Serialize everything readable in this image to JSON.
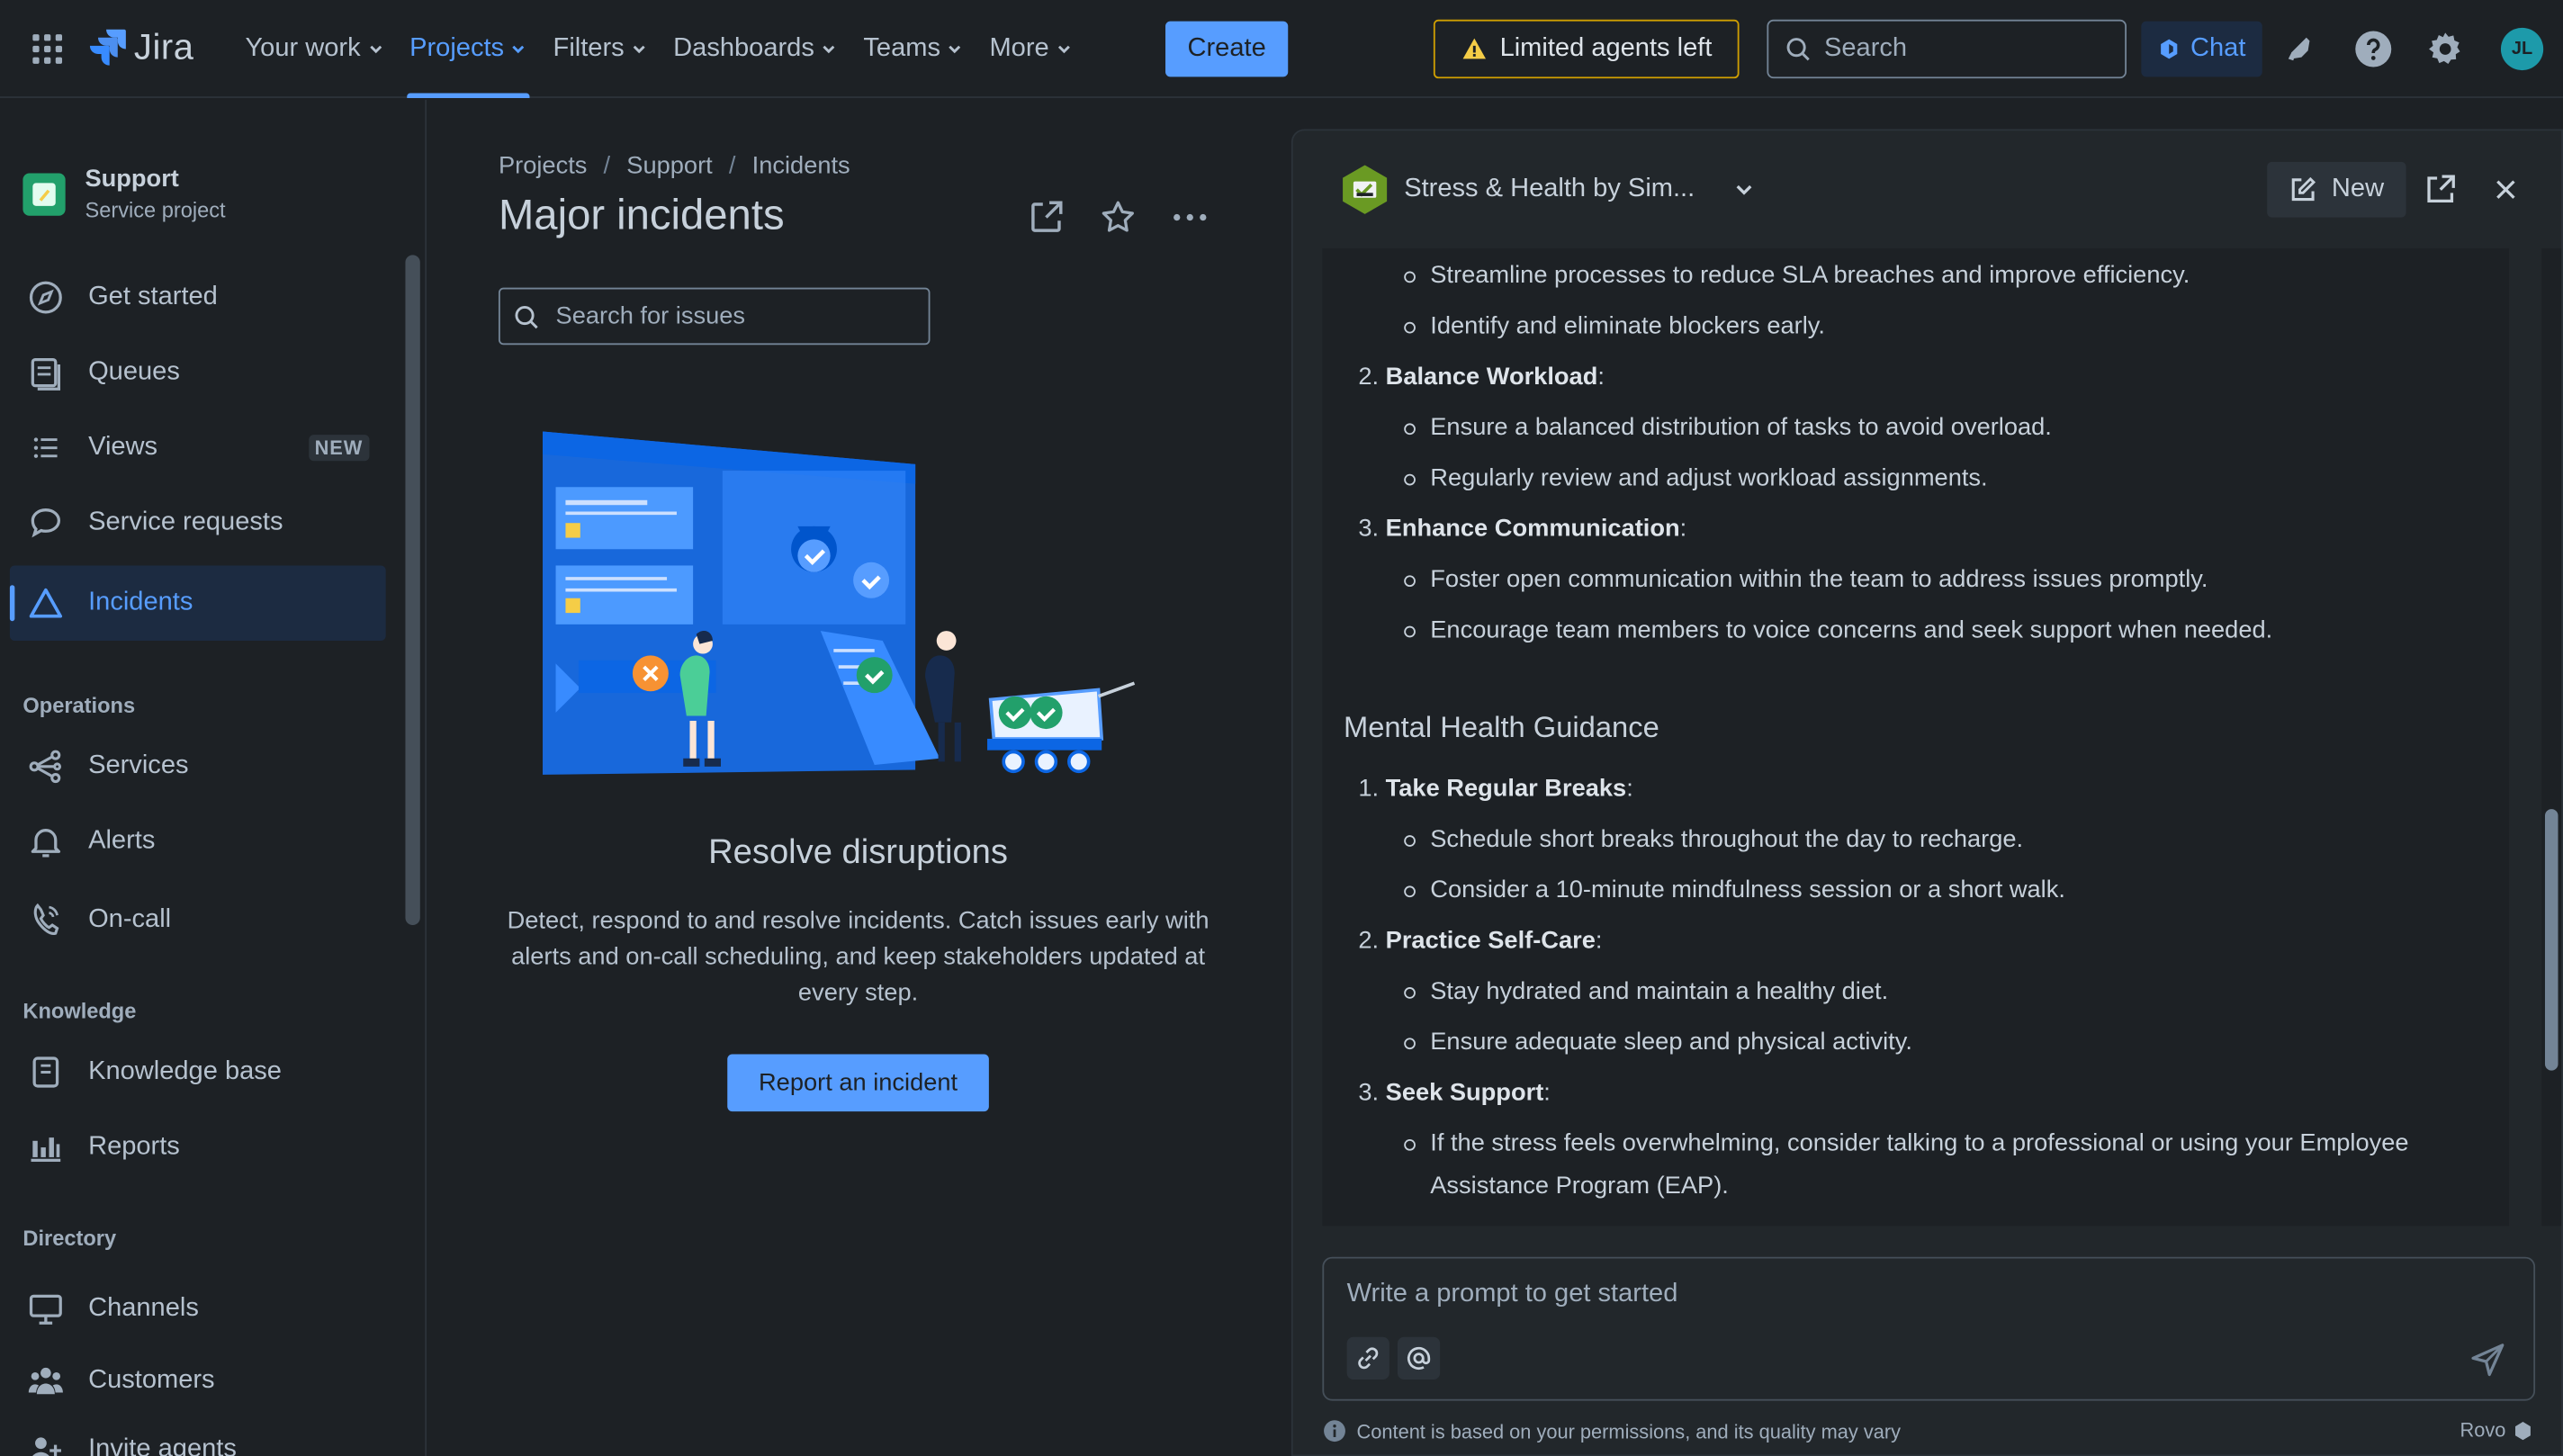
{
  "topnav": {
    "logo": "Jira",
    "menu": [
      {
        "label": "Your work"
      },
      {
        "label": "Projects"
      },
      {
        "label": "Filters"
      },
      {
        "label": "Dashboards"
      },
      {
        "label": "Teams"
      },
      {
        "label": "More"
      }
    ],
    "create_label": "Create",
    "limited_label": "Limited agents left",
    "search_placeholder": "Search",
    "chat_label": "Chat",
    "avatar_initials": "JL"
  },
  "sidebar": {
    "project_name": "Support",
    "project_type": "Service project",
    "items": [
      {
        "label": "Get started"
      },
      {
        "label": "Queues"
      },
      {
        "label": "Views",
        "badge": "NEW"
      },
      {
        "label": "Service requests"
      },
      {
        "label": "Incidents"
      }
    ],
    "operations_heading": "Operations",
    "operations": [
      {
        "label": "Services"
      },
      {
        "label": "Alerts"
      },
      {
        "label": "On-call"
      }
    ],
    "knowledge_heading": "Knowledge",
    "knowledge": [
      {
        "label": "Knowledge base"
      },
      {
        "label": "Reports"
      }
    ],
    "directory_heading": "Directory",
    "directory": [
      {
        "label": "Channels"
      },
      {
        "label": "Customers"
      },
      {
        "label": "Invite agents"
      }
    ]
  },
  "main": {
    "breadcrumbs": [
      "Projects",
      "Support",
      "Incidents"
    ],
    "title": "Major incidents",
    "search_placeholder": "Search for issues",
    "empty_title": "Resolve disruptions",
    "empty_desc": "Detect, respond to and resolve incidents. Catch issues early with alerts and on-call scheduling, and keep stakeholders updated at every step.",
    "report_button": "Report an incident"
  },
  "panel": {
    "agent_name": "Stress & Health by Sim...",
    "new_label": "New",
    "content": {
      "b1": "Streamline processes to reduce SLA breaches and improve efficiency.",
      "b2": "Identify and eliminate blockers early.",
      "n2_num": "2.",
      "n2_title": "Balance Workload",
      "b3": "Ensure a balanced distribution of tasks to avoid overload.",
      "b4": "Regularly review and adjust workload assignments.",
      "n3_num": "3.",
      "n3_title": "Enhance Communication",
      "b5": "Foster open communication within the team to address issues promptly.",
      "b6": "Encourage team members to voice concerns and seek support when needed.",
      "heading": "Mental Health Guidance",
      "m1_num": "1.",
      "m1_title": "Take Regular Breaks",
      "b7": "Schedule short breaks throughout the day to recharge.",
      "b8": "Consider a 10-minute mindfulness session or a short walk.",
      "m2_num": "2.",
      "m2_title": "Practice Self-Care",
      "b9": "Stay hydrated and maintain a healthy diet.",
      "b10": "Ensure adequate sleep and physical activity.",
      "m3_num": "3.",
      "m3_title": "Seek Support",
      "b11": "If the stress feels overwhelming, consider talking to a professional or using your Employee Assistance Program (EAP)."
    },
    "prompt_placeholder": "Write a prompt to get started",
    "disclaimer": "Content is based on your permissions, and its quality may vary",
    "brand": "Rovo"
  },
  "colors": {
    "accent": "#579dff",
    "warning": "#cf9f02",
    "background": "#1d2125",
    "agent": "#6a9a23"
  }
}
